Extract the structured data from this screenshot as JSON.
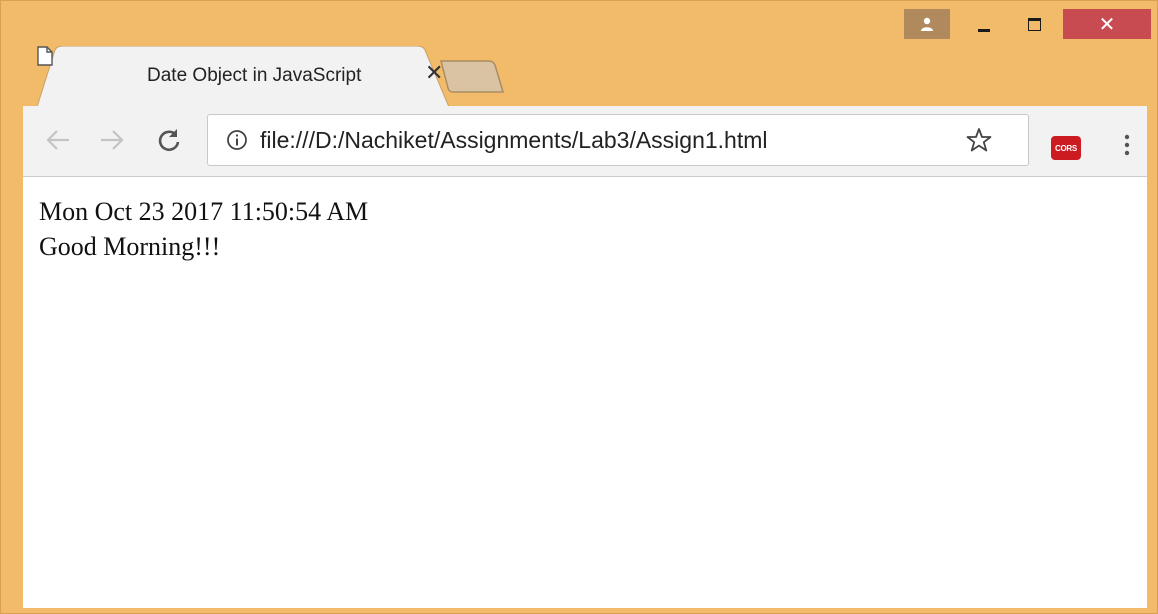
{
  "window": {
    "frame_color": "#f2bb6a",
    "close_color": "#c94b52"
  },
  "caption": {
    "profile_icon": "person-icon",
    "minimize_icon": "minimize-icon",
    "maximize_icon": "maximize-icon",
    "close_glyph": "✕"
  },
  "tab": {
    "title": "Date Object in JavaScript",
    "icon": "page-icon",
    "close_glyph": "✕"
  },
  "toolbar": {
    "back_icon": "arrow-left-icon",
    "forward_icon": "arrow-right-icon",
    "reload_icon": "reload-icon",
    "url": "file:///D:/Nachiket/Assignments/Lab3/Assign1.html",
    "info_icon": "info-icon",
    "bookmark_icon": "star-icon",
    "extension_label": "CORS",
    "extension_color": "#cc1c22",
    "menu_icon": "vertical-dots-icon"
  },
  "page": {
    "date_text": "Mon Oct 23 2017 11:50:54 AM",
    "greeting": "Good Morning!!!"
  }
}
